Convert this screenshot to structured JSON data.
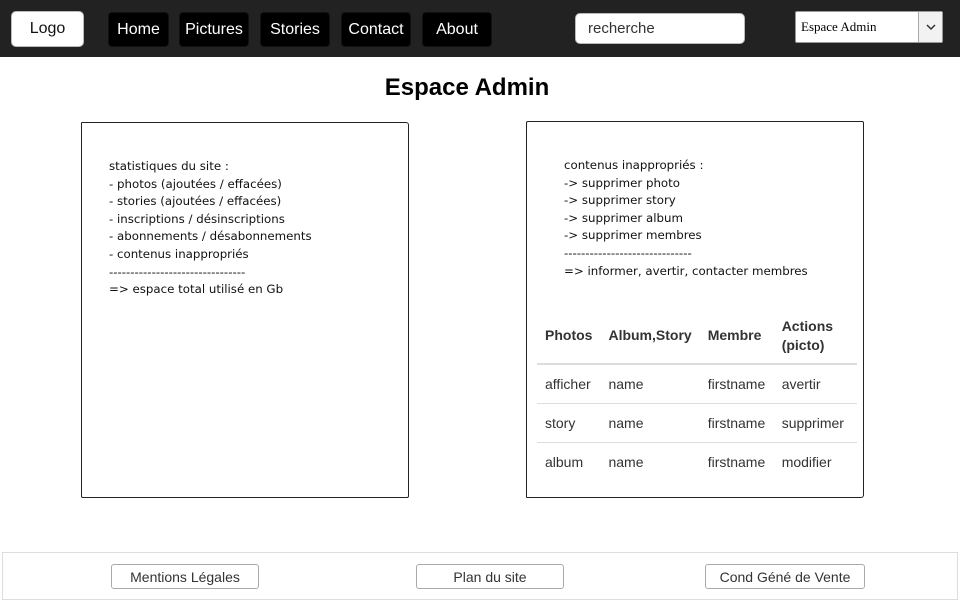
{
  "header": {
    "logo_label": "Logo",
    "nav": [
      {
        "label": "Home"
      },
      {
        "label": "Pictures"
      },
      {
        "label": "Stories"
      },
      {
        "label": "Contact"
      },
      {
        "label": "About"
      }
    ],
    "search": {
      "value": "recherche"
    },
    "space_select": {
      "selected": "Espace Admin",
      "arrow_icon": "chevron-down-icon"
    }
  },
  "main": {
    "title": "Espace Admin",
    "stats_note": "statistiques du site :\n- photos (ajoutées / effacées)\n- stories (ajoutées / effacées)\n- inscriptions / désinscriptions\n- abonnements / désabonnements\n- contenus inappropriés\n--------------------------------\n=> espace total utilisé en Gb",
    "moderation_note": "contenus inappropriés :\n-> supprimer photo\n-> supprimer story\n-> supprimer album\n-> supprimer membres\n------------------------------\n=> informer, avertir, contacter membres",
    "table": {
      "headers": [
        "Photos",
        "Album,Story",
        "Membre",
        "Actions\n(picto)"
      ],
      "rows": [
        [
          "afficher",
          "name",
          "firstname",
          "avertir"
        ],
        [
          "story",
          "name",
          "firstname",
          "supprimer"
        ],
        [
          "album",
          "name",
          "firstname",
          "modifier"
        ]
      ]
    }
  },
  "footer": {
    "links": [
      {
        "label": "Mentions Légales"
      },
      {
        "label": "Plan du site"
      },
      {
        "label": "Cond Géné de Vente"
      }
    ]
  },
  "colors": {
    "topbar": "#222222",
    "nav_button": "#000000",
    "nav_text": "#ffffff"
  }
}
